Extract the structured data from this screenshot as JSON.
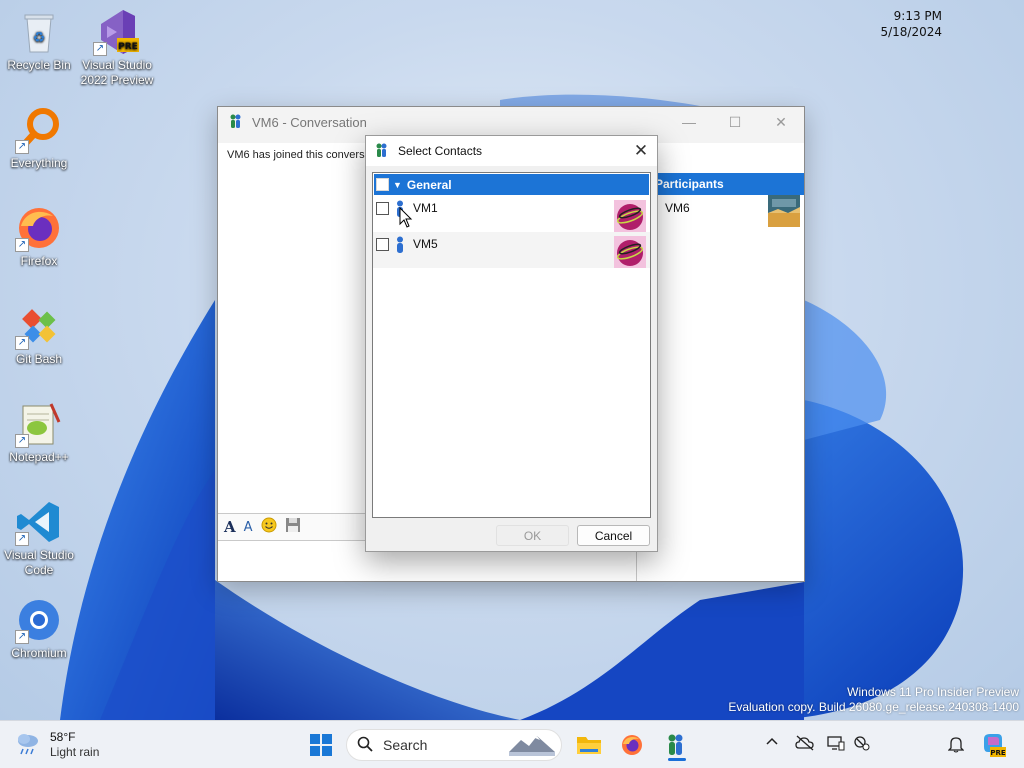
{
  "desktop": {
    "icons": [
      {
        "label": "Recycle Bin"
      },
      {
        "label": "Visual Studio 2022 Preview",
        "badge": "PRE"
      },
      {
        "label": "Everything"
      },
      {
        "label": "Firefox"
      },
      {
        "label": "Git Bash"
      },
      {
        "label": "Notepad++"
      },
      {
        "label": "Visual Studio Code"
      },
      {
        "label": "Chromium"
      }
    ],
    "watermark_line1": "Windows 11 Pro Insider Preview",
    "watermark_line2": "Evaluation copy. Build 26080.ge_release.240308-1400"
  },
  "conversation_window": {
    "title": "VM6 - Conversation",
    "message": "VM6 has joined this conversa",
    "participants_header": "Participants",
    "participants": [
      {
        "name": "VM6"
      }
    ]
  },
  "select_contacts": {
    "title": "Select Contacts",
    "group_name": "General",
    "contacts": [
      {
        "name": "VM1"
      },
      {
        "name": "VM5"
      }
    ],
    "ok_label": "OK",
    "cancel_label": "Cancel"
  },
  "taskbar": {
    "weather_temp": "58°F",
    "weather_desc": "Light rain",
    "search_label": "Search",
    "time": "9:13 PM",
    "date": "5/18/2024",
    "copilot_badge": "PRE"
  },
  "colors": {
    "selection_blue": "#1c74d6",
    "taskbar_bg": "#eef1f6"
  }
}
